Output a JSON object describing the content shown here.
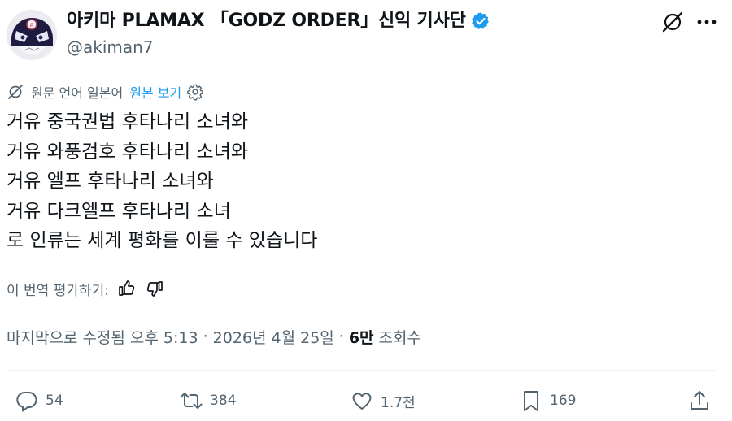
{
  "author": {
    "display_name": "아키마 PLAMAX 「GODZ ORDER」신익 기사단",
    "handle": "@akiman7",
    "verified_color": "#1d9bf0"
  },
  "translation": {
    "label": "원문 언어 일본어",
    "show_original": "원본 보기"
  },
  "tweet": {
    "lines": [
      "거유 중국권법 후타나리 소녀와",
      "거유 와풍검호 후타나리 소녀와",
      "거유 엘프 후타나리 소녀와",
      "거유 다크엘프 후타나리 소녀",
      "로 인류는 세계 평화를 이룰 수 있습니다"
    ]
  },
  "rating": {
    "label": "이 번역 평가하기:"
  },
  "meta": {
    "edited": "마지막으로 수정됨 오후 5:13",
    "separator": "·",
    "date": "2026년 4월 25일",
    "views_count": "6만",
    "views_label": "조회수"
  },
  "actions": {
    "replies": "54",
    "retweets": "384",
    "likes": "1.7천",
    "bookmarks": "169"
  },
  "colors": {
    "text": "#0f1419",
    "secondary": "#536471",
    "accent": "#1d9bf0"
  }
}
